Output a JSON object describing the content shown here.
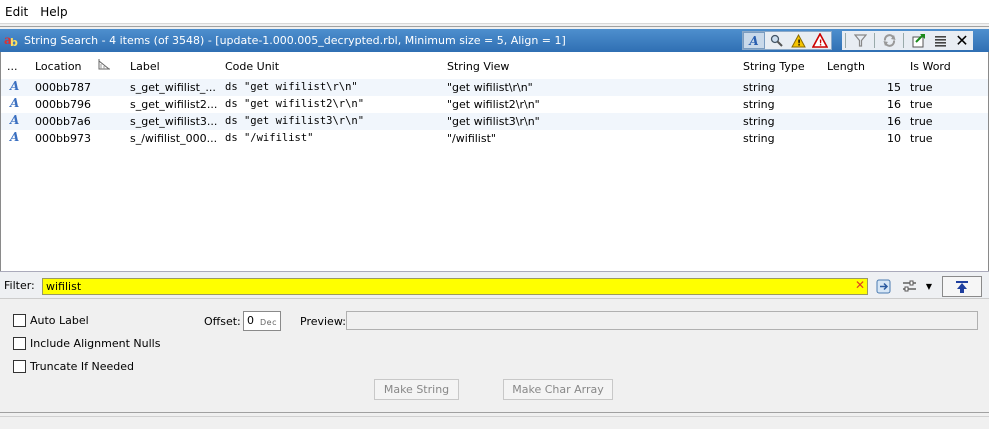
{
  "menu": {
    "items": [
      "Edit",
      "Help"
    ]
  },
  "window": {
    "title": "String Search - 4 items (of 3548) - [update-1.000.005_decrypted.rbl, Minimum size = 5, Align = 1]"
  },
  "toolbar": {
    "icons": [
      "string-icon",
      "search-icon",
      "warning-icon",
      "error-icon",
      "filter-icon",
      "refresh-icon",
      "export-icon",
      "list-icon",
      "close-icon"
    ]
  },
  "table": {
    "columns": {
      "more": "...",
      "location": "Location",
      "label": "Label",
      "code_unit": "Code Unit",
      "string_view": "String View",
      "string_type": "String Type",
      "length": "Length",
      "is_word": "Is Word"
    },
    "rows": [
      {
        "location": "000bb787",
        "label": "s_get_wifilist_...",
        "code_unit": "ds \"get wifilist\\r\\n\"",
        "string_view": "\"get wifilist\\r\\n\"",
        "string_type": "string",
        "length": "15",
        "is_word": "true"
      },
      {
        "location": "000bb796",
        "label": "s_get_wifilist2...",
        "code_unit": "ds \"get wifilist2\\r\\n\"",
        "string_view": "\"get wifilist2\\r\\n\"",
        "string_type": "string",
        "length": "16",
        "is_word": "true"
      },
      {
        "location": "000bb7a6",
        "label": "s_get_wifilist3...",
        "code_unit": "ds \"get wifilist3\\r\\n\"",
        "string_view": "\"get wifilist3\\r\\n\"",
        "string_type": "string",
        "length": "16",
        "is_word": "true"
      },
      {
        "location": "000bb973",
        "label": "s_/wifilist_000...",
        "code_unit": "ds \"/wifilist\"",
        "string_view": "\"/wifilist\"",
        "string_type": "string",
        "length": "10",
        "is_word": "true"
      }
    ]
  },
  "filter": {
    "label": "Filter:",
    "value": "wifilist",
    "highlight_color": "#ffff00"
  },
  "options": {
    "auto_label": "Auto Label",
    "include_alignment_nulls": "Include Alignment Nulls",
    "truncate_if_needed": "Truncate If Needed",
    "offset_label": "Offset:",
    "offset_value": "0",
    "offset_format": "Dec",
    "preview_label": "Preview:",
    "make_string": "Make String",
    "make_char_array": "Make Char Array"
  },
  "colors": {
    "title_bar": "#3a7bc0",
    "row_alt": "#f1f6fc"
  }
}
